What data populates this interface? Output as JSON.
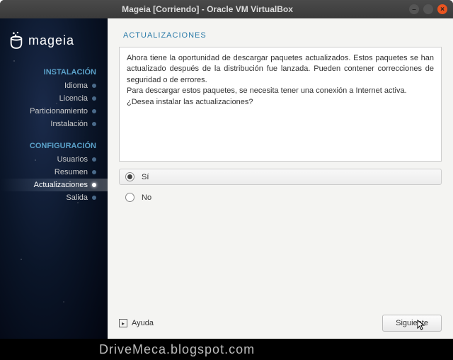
{
  "window": {
    "title": "Mageia [Corriendo] - Oracle VM VirtualBox"
  },
  "logo": {
    "text": "mageia"
  },
  "sidebar": {
    "sections": [
      {
        "heading": "INSTALACIÓN",
        "items": [
          {
            "label": "Idioma",
            "active": false
          },
          {
            "label": "Licencia",
            "active": false
          },
          {
            "label": "Particionamiento",
            "active": false
          },
          {
            "label": "Instalación",
            "active": false
          }
        ]
      },
      {
        "heading": "CONFIGURACIÓN",
        "items": [
          {
            "label": "Usuarios",
            "active": false
          },
          {
            "label": "Resumen",
            "active": false
          },
          {
            "label": "Actualizaciones",
            "active": true
          },
          {
            "label": "Salida",
            "active": false
          }
        ]
      }
    ]
  },
  "panel": {
    "title": "ACTUALIZACIONES",
    "body1": "Ahora tiene la oportunidad de descargar paquetes actualizados. Estos paquetes se han actualizado después de la distribución fue lanzada. Pueden contener correcciones de seguridad o de errores.",
    "body2": "Para descargar estos paquetes, se necesita tener una conexión a Internet activa.",
    "body3": "¿Desea instalar las actualizaciones?"
  },
  "options": {
    "yes": "Sí",
    "no": "No",
    "selected": "yes"
  },
  "footer": {
    "help": "Ayuda",
    "next": "Siguiente"
  },
  "watermark": "DriveMeca.blogspot.com"
}
